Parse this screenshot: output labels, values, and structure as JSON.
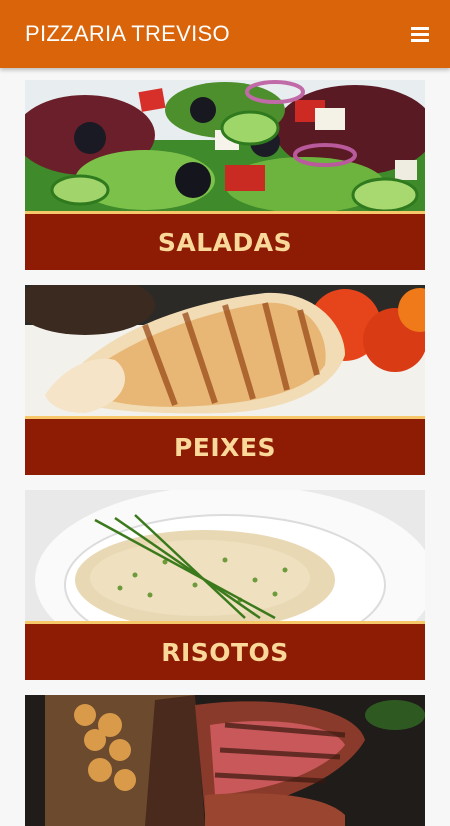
{
  "app": {
    "title": "PIZZARIA TREVISO"
  },
  "categories": [
    {
      "label": "SALADAS",
      "image": "salad-photo"
    },
    {
      "label": "PEIXES",
      "image": "grilled-fish-photo"
    },
    {
      "label": "RISOTOS",
      "image": "risotto-photo"
    },
    {
      "label": "",
      "image": "grilled-steak-photo"
    }
  ],
  "colors": {
    "appbar": "#d9640a",
    "label_bg": "#8e1b04",
    "label_text": "#f9d89a"
  }
}
